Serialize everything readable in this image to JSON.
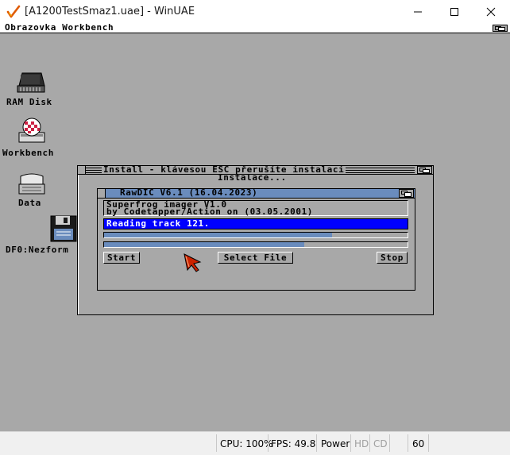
{
  "window": {
    "title": "[A1200TestSmaz1.uae] - WinUAE",
    "controls": {
      "minimize": "minimize",
      "maximize": "maximize",
      "close": "close"
    }
  },
  "screen": {
    "title": "Obrazovka Workbench"
  },
  "desktop_icons": [
    {
      "label": "RAM Disk",
      "icon": "ram-disk-icon"
    },
    {
      "label": "Workbench",
      "icon": "workbench-disk-icon"
    },
    {
      "label": "Data",
      "icon": "hard-drive-icon"
    },
    {
      "label": "DF0:Nezform",
      "icon": "floppy-disk-icon"
    }
  ],
  "install_window": {
    "title": "Install - klávesou ESC přerušíte instalaci",
    "status": "Instalace...",
    "hidden_text": "...."
  },
  "rawdic": {
    "title": "RawDIC V6.1 (16.04.2023)",
    "info_line1": "Superfrog imager V1.0",
    "info_line2": "by Codetapper/Action on (03.05.2001)",
    "status": "Reading track 121.",
    "progress1": 0.75,
    "progress2": 0.66,
    "buttons": {
      "start": "Start",
      "select_file": "Select File",
      "stop": "Stop"
    }
  },
  "statusbar": {
    "cpu": "CPU: 100%",
    "fps": "FPS: 49.8",
    "power": "Power",
    "hd": "HD",
    "cd": "CD",
    "vol": "60"
  },
  "colors": {
    "amiga_grey": "#a8a8a8",
    "amiga_blue": "#6a8cbd",
    "status_blue": "#0000ff",
    "cursor_red": "#cc2200"
  }
}
